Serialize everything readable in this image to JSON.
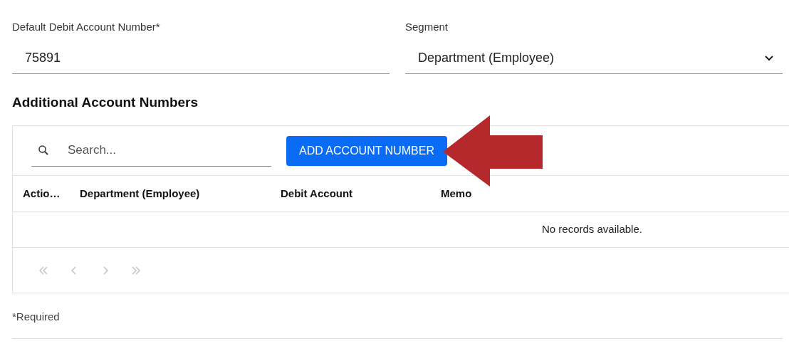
{
  "fields": [
    {
      "kind": "text",
      "label": "Default Debit Account Number*",
      "value": "75891"
    },
    {
      "kind": "select",
      "label": "Segment",
      "value": "Department (Employee)"
    }
  ],
  "section_title": "Additional Account Numbers",
  "toolbar": {
    "search": {
      "placeholder": "Search..."
    },
    "add_button": "ADD ACCOUNT NUMBER"
  },
  "table": {
    "columns": [
      "Actio…",
      "Department (Employee)",
      "Debit Account",
      "Memo"
    ],
    "empty_message": "No records available."
  },
  "pager": {
    "disabled": true
  },
  "footnote": "*Required"
}
